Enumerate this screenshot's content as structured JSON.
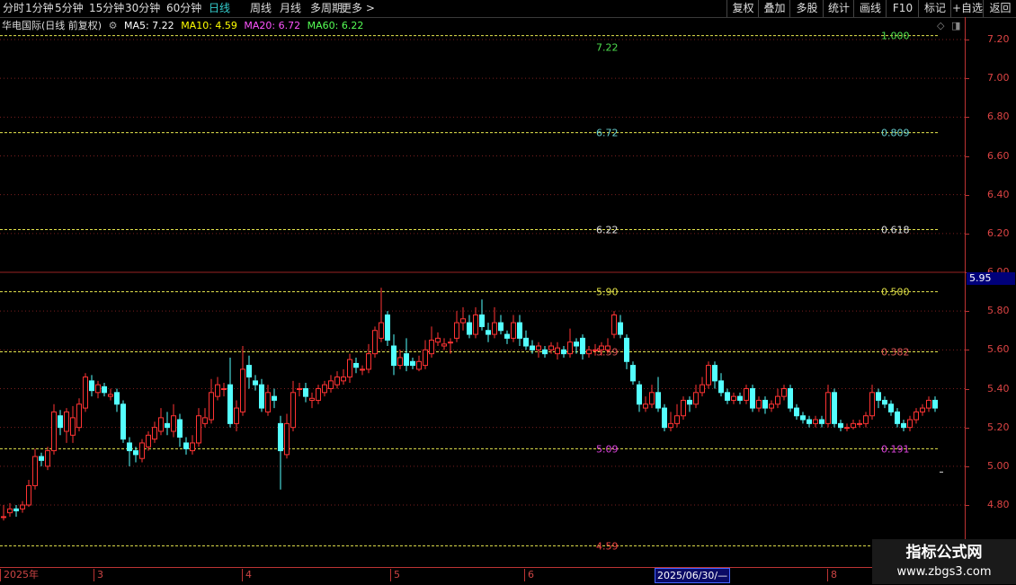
{
  "toolbar": {
    "periods": [
      "分时",
      "1分钟",
      "5分钟",
      "15分钟",
      "30分钟",
      "60分钟",
      "日线",
      "周线",
      "月线",
      "多周期",
      "更多 >"
    ],
    "active_period": "日线",
    "right_buttons": [
      "复权",
      "叠加",
      "多股",
      "统计",
      "画线",
      "F10",
      "标记",
      "+自选",
      "返回"
    ]
  },
  "info": {
    "stock": "华电国际(日线 前复权)",
    "ma5": "MA5: 7.22",
    "ma10": "MA10: 4.59",
    "ma20": "MA20: 6.72",
    "ma60": "MA60: 6.22",
    "colors": {
      "ma5": "#ffffff",
      "ma10": "#ffff00",
      "ma20": "#ff55ff",
      "ma60": "#55ff55"
    }
  },
  "price_axis": {
    "labels": [
      "7.20",
      "7.00",
      "6.80",
      "6.60",
      "6.40",
      "6.20",
      "6.00",
      "5.80",
      "5.60",
      "5.40",
      "5.20",
      "5.00",
      "4.80"
    ],
    "current": "5.95"
  },
  "fib_levels": [
    {
      "price": 7.22,
      "label": "7.22",
      "ratio": "1.000",
      "color": "#4ddd4d"
    },
    {
      "price": 6.72,
      "label": "6.72",
      "ratio": "0.809",
      "color": "#66cccc"
    },
    {
      "price": 6.22,
      "label": "6.22",
      "ratio": "0.618",
      "color": "#dddddd"
    },
    {
      "price": 5.9,
      "label": "5.90",
      "ratio": "0.500",
      "color": "#dddd44"
    },
    {
      "price": 5.59,
      "label": "5.59",
      "ratio": "0.382",
      "color": "#dd5555"
    },
    {
      "price": 5.09,
      "label": "5.09",
      "ratio": "0.191",
      "color": "#dd44dd"
    },
    {
      "price": 4.59,
      "label": "4.59",
      "ratio": "",
      "color": "#ee4444"
    }
  ],
  "dates": {
    "labels": [
      "2025年",
      "3",
      "4",
      "5",
      "6",
      "8"
    ],
    "cursor": "2025/06/30/—"
  },
  "chart_data": {
    "type": "candlestick",
    "y_range": [
      4.66,
      7.22
    ],
    "up_color": "#ff3333",
    "down_color": "#54ffff",
    "candles": [
      [
        4.74,
        4.74,
        4.8,
        4.72
      ],
      [
        4.76,
        4.78,
        4.81,
        4.74
      ],
      [
        4.78,
        4.77,
        4.8,
        4.74
      ],
      [
        4.78,
        4.8,
        4.82,
        4.76
      ],
      [
        4.8,
        4.9,
        4.93,
        4.79
      ],
      [
        4.9,
        5.05,
        5.09,
        4.88
      ],
      [
        5.05,
        5.03,
        5.07,
        5.0
      ],
      [
        5.0,
        5.08,
        5.1,
        4.98
      ],
      [
        5.08,
        5.28,
        5.32,
        5.06
      ],
      [
        5.26,
        5.2,
        5.29,
        5.16
      ],
      [
        5.18,
        5.28,
        5.3,
        5.12
      ],
      [
        5.16,
        5.25,
        5.31,
        5.12
      ],
      [
        5.2,
        5.32,
        5.35,
        5.18
      ],
      [
        5.3,
        5.46,
        5.48,
        5.28
      ],
      [
        5.44,
        5.39,
        5.47,
        5.36
      ],
      [
        5.38,
        5.42,
        5.44,
        5.35
      ],
      [
        5.41,
        5.38,
        5.43,
        5.36
      ],
      [
        5.36,
        5.37,
        5.4,
        5.34
      ],
      [
        5.38,
        5.32,
        5.4,
        5.28
      ],
      [
        5.32,
        5.14,
        5.34,
        5.12
      ],
      [
        5.12,
        5.08,
        5.15,
        5.0
      ],
      [
        5.08,
        5.06,
        5.1,
        5.02
      ],
      [
        5.04,
        5.12,
        5.14,
        5.02
      ],
      [
        5.1,
        5.16,
        5.18,
        5.08
      ],
      [
        5.14,
        5.2,
        5.23,
        5.12
      ],
      [
        5.18,
        5.25,
        5.3,
        5.16
      ],
      [
        5.22,
        5.2,
        5.28,
        5.16
      ],
      [
        5.18,
        5.26,
        5.32,
        5.15
      ],
      [
        5.24,
        5.15,
        5.27,
        5.1
      ],
      [
        5.12,
        5.09,
        5.15,
        5.06
      ],
      [
        5.08,
        5.12,
        5.16,
        5.06
      ],
      [
        5.12,
        5.26,
        5.3,
        5.1
      ],
      [
        5.22,
        5.25,
        5.3,
        5.2
      ],
      [
        5.24,
        5.38,
        5.45,
        5.22
      ],
      [
        5.36,
        5.42,
        5.46,
        5.34
      ],
      [
        5.4,
        5.4,
        5.43,
        5.36
      ],
      [
        5.42,
        5.22,
        5.56,
        5.2
      ],
      [
        5.22,
        5.3,
        5.34,
        5.18
      ],
      [
        5.28,
        5.5,
        5.62,
        5.26
      ],
      [
        5.52,
        5.46,
        5.57,
        5.4
      ],
      [
        5.44,
        5.42,
        5.47,
        5.39
      ],
      [
        5.42,
        5.3,
        5.45,
        5.28
      ],
      [
        5.28,
        5.38,
        5.42,
        5.26
      ],
      [
        5.36,
        5.34,
        5.4,
        5.3
      ],
      [
        5.22,
        5.08,
        5.26,
        4.88
      ],
      [
        5.06,
        5.22,
        5.27,
        5.04
      ],
      [
        5.2,
        5.38,
        5.44,
        5.18
      ],
      [
        5.4,
        5.4,
        5.43,
        5.36
      ],
      [
        5.4,
        5.36,
        5.43,
        5.33
      ],
      [
        5.34,
        5.35,
        5.38,
        5.3
      ],
      [
        5.34,
        5.4,
        5.42,
        5.32
      ],
      [
        5.38,
        5.42,
        5.44,
        5.36
      ],
      [
        5.4,
        5.44,
        5.47,
        5.38
      ],
      [
        5.42,
        5.46,
        5.49,
        5.4
      ],
      [
        5.44,
        5.46,
        5.5,
        5.42
      ],
      [
        5.46,
        5.55,
        5.58,
        5.43
      ],
      [
        5.53,
        5.51,
        5.56,
        5.48
      ],
      [
        5.5,
        5.5,
        5.52,
        5.47
      ],
      [
        5.5,
        5.58,
        5.63,
        5.48
      ],
      [
        5.58,
        5.7,
        5.72,
        5.56
      ],
      [
        5.66,
        5.74,
        5.92,
        5.64
      ],
      [
        5.78,
        5.65,
        5.8,
        5.62
      ],
      [
        5.62,
        5.52,
        5.68,
        5.47
      ],
      [
        5.52,
        5.56,
        5.6,
        5.5
      ],
      [
        5.58,
        5.52,
        5.66,
        5.49
      ],
      [
        5.54,
        5.52,
        5.56,
        5.5
      ],
      [
        5.5,
        5.54,
        5.57,
        5.49
      ],
      [
        5.52,
        5.6,
        5.65,
        5.5
      ],
      [
        5.58,
        5.65,
        5.72,
        5.56
      ],
      [
        5.64,
        5.66,
        5.69,
        5.62
      ],
      [
        5.62,
        5.63,
        5.66,
        5.6
      ],
      [
        5.64,
        5.64,
        5.66,
        5.58
      ],
      [
        5.66,
        5.74,
        5.8,
        5.64
      ],
      [
        5.74,
        5.76,
        5.82,
        5.7
      ],
      [
        5.74,
        5.68,
        5.78,
        5.66
      ],
      [
        5.68,
        5.78,
        5.82,
        5.66
      ],
      [
        5.78,
        5.72,
        5.86,
        5.7
      ],
      [
        5.7,
        5.68,
        5.74,
        5.64
      ],
      [
        5.68,
        5.74,
        5.82,
        5.66
      ],
      [
        5.74,
        5.7,
        5.78,
        5.68
      ],
      [
        5.68,
        5.66,
        5.7,
        5.63
      ],
      [
        5.66,
        5.74,
        5.78,
        5.64
      ],
      [
        5.74,
        5.66,
        5.78,
        5.62
      ],
      [
        5.66,
        5.62,
        5.7,
        5.6
      ],
      [
        5.62,
        5.6,
        5.65,
        5.58
      ],
      [
        5.6,
        5.62,
        5.64,
        5.56
      ],
      [
        5.6,
        5.58,
        5.62,
        5.56
      ],
      [
        5.6,
        5.62,
        5.64,
        5.58
      ],
      [
        5.58,
        5.61,
        5.64,
        5.55
      ],
      [
        5.6,
        5.58,
        5.62,
        5.56
      ],
      [
        5.58,
        5.64,
        5.71,
        5.56
      ],
      [
        5.64,
        5.62,
        5.66,
        5.58
      ],
      [
        5.66,
        5.58,
        5.68,
        5.55
      ],
      [
        5.58,
        5.6,
        5.62,
        5.56
      ],
      [
        5.6,
        5.6,
        5.63,
        5.57
      ],
      [
        5.6,
        5.62,
        5.64,
        5.57
      ],
      [
        5.6,
        5.62,
        5.66,
        5.58
      ],
      [
        5.68,
        5.78,
        5.8,
        5.66
      ],
      [
        5.74,
        5.68,
        5.78,
        5.66
      ],
      [
        5.66,
        5.54,
        5.68,
        5.5
      ],
      [
        5.52,
        5.44,
        5.54,
        5.42
      ],
      [
        5.42,
        5.32,
        5.44,
        5.28
      ],
      [
        5.3,
        5.32,
        5.36,
        5.28
      ],
      [
        5.32,
        5.38,
        5.42,
        5.3
      ],
      [
        5.38,
        5.3,
        5.46,
        5.28
      ],
      [
        5.3,
        5.2,
        5.32,
        5.18
      ],
      [
        5.2,
        5.22,
        5.28,
        5.18
      ],
      [
        5.22,
        5.26,
        5.32,
        5.2
      ],
      [
        5.26,
        5.34,
        5.36,
        5.24
      ],
      [
        5.34,
        5.32,
        5.36,
        5.28
      ],
      [
        5.32,
        5.38,
        5.42,
        5.3
      ],
      [
        5.38,
        5.42,
        5.46,
        5.36
      ],
      [
        5.42,
        5.52,
        5.54,
        5.4
      ],
      [
        5.52,
        5.44,
        5.54,
        5.4
      ],
      [
        5.44,
        5.38,
        5.48,
        5.36
      ],
      [
        5.38,
        5.34,
        5.4,
        5.32
      ],
      [
        5.34,
        5.36,
        5.38,
        5.32
      ],
      [
        5.36,
        5.34,
        5.38,
        5.32
      ],
      [
        5.34,
        5.4,
        5.42,
        5.32
      ],
      [
        5.4,
        5.3,
        5.42,
        5.28
      ],
      [
        5.3,
        5.34,
        5.36,
        5.28
      ],
      [
        5.34,
        5.3,
        5.36,
        5.27
      ],
      [
        5.3,
        5.32,
        5.34,
        5.28
      ],
      [
        5.32,
        5.36,
        5.4,
        5.3
      ],
      [
        5.36,
        5.4,
        5.42,
        5.34
      ],
      [
        5.4,
        5.3,
        5.42,
        5.28
      ],
      [
        5.3,
        5.26,
        5.32,
        5.24
      ],
      [
        5.26,
        5.24,
        5.28,
        5.22
      ],
      [
        5.24,
        5.22,
        5.26,
        5.2
      ],
      [
        5.22,
        5.24,
        5.26,
        5.2
      ],
      [
        5.24,
        5.22,
        5.26,
        5.2
      ],
      [
        5.22,
        5.38,
        5.42,
        5.2
      ],
      [
        5.38,
        5.22,
        5.4,
        5.2
      ],
      [
        5.22,
        5.2,
        5.24,
        5.18
      ],
      [
        5.2,
        5.2,
        5.22,
        5.18
      ],
      [
        5.2,
        5.22,
        5.24,
        5.19
      ],
      [
        5.22,
        5.22,
        5.24,
        5.2
      ],
      [
        5.22,
        5.26,
        5.28,
        5.2
      ],
      [
        5.26,
        5.38,
        5.42,
        5.24
      ],
      [
        5.38,
        5.34,
        5.4,
        5.3
      ],
      [
        5.34,
        5.32,
        5.36,
        5.3
      ],
      [
        5.32,
        5.28,
        5.34,
        5.26
      ],
      [
        5.28,
        5.22,
        5.3,
        5.2
      ],
      [
        5.22,
        5.2,
        5.24,
        5.18
      ],
      [
        5.2,
        5.24,
        5.26,
        5.18
      ],
      [
        5.24,
        5.28,
        5.3,
        5.22
      ],
      [
        5.28,
        5.3,
        5.32,
        5.26
      ],
      [
        5.3,
        5.34,
        5.36,
        5.28
      ],
      [
        5.34,
        5.3,
        5.36,
        5.28
      ]
    ]
  },
  "watermark": {
    "line1": "指标公式网",
    "line2": "www.zbgs3.com"
  }
}
